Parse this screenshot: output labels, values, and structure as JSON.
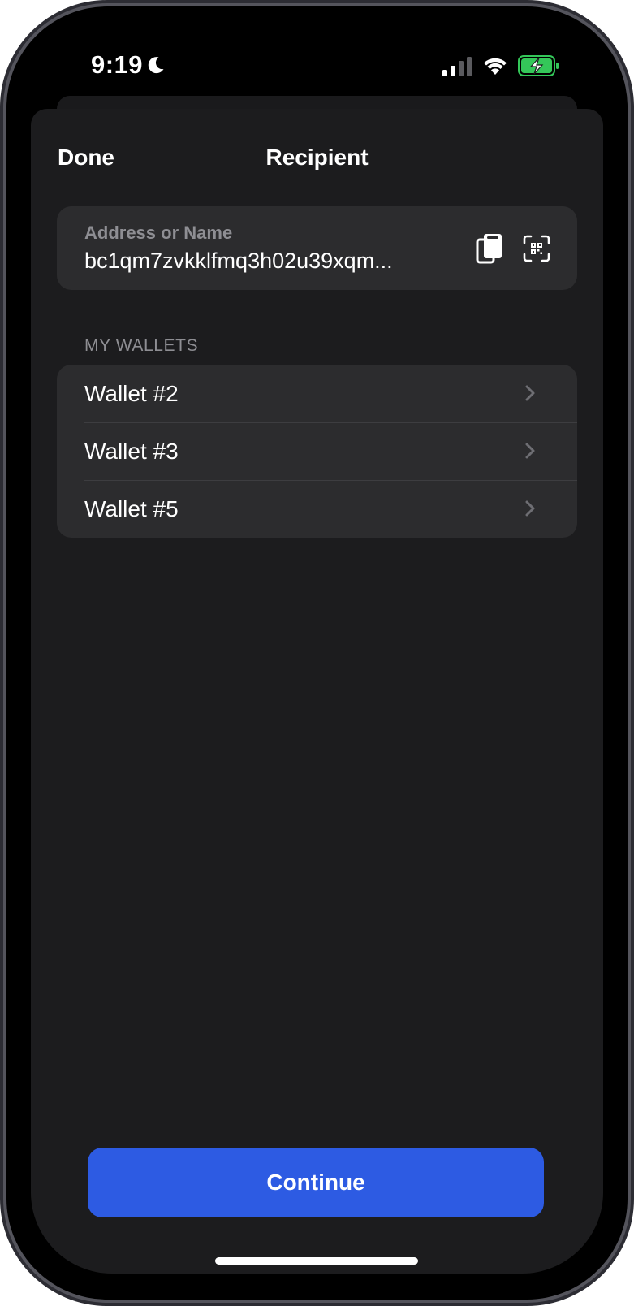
{
  "status_bar": {
    "time": "9:19",
    "moon_icon": "moon-icon",
    "signal_icon": "cellular-signal-icon",
    "wifi_icon": "wifi-icon",
    "battery_icon": "battery-charging-icon",
    "battery_color": "#34c759"
  },
  "nav": {
    "done_label": "Done",
    "title": "Recipient"
  },
  "address": {
    "label": "Address or Name",
    "value": "bc1qm7zvkklfmq3h02u39xqm...",
    "paste_icon": "paste-icon",
    "scan_icon": "qr-scan-icon"
  },
  "wallets": {
    "header": "MY WALLETS",
    "items": [
      {
        "label": "Wallet #2"
      },
      {
        "label": "Wallet #3"
      },
      {
        "label": "Wallet #5"
      }
    ]
  },
  "continue_label": "Continue",
  "colors": {
    "accent": "#2d5be3",
    "sheet_background": "#1c1c1e",
    "card_background": "#2c2c2e",
    "secondary_text": "#8e8e93"
  }
}
